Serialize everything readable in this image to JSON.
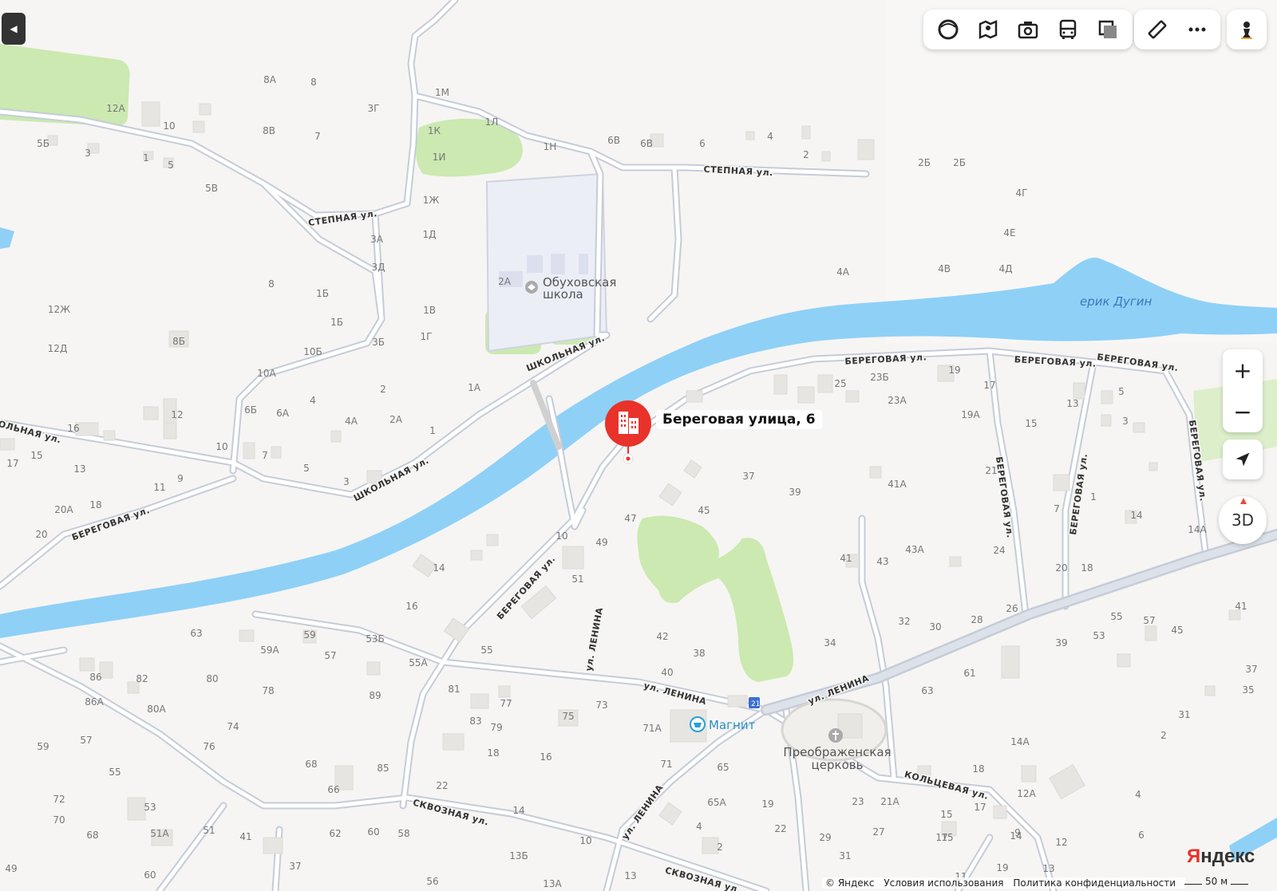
{
  "colors": {
    "water": "#8fd0f7",
    "park": "#cbe9b0",
    "road_fill": "#ffffff",
    "road_stroke": "#c5ccd8",
    "building": "#e9e7e3",
    "school_area": "#eceef6",
    "pin": "#e8322a",
    "label": "#6f6f6f",
    "street_label": "#333333",
    "water_label": "#3d78b8"
  },
  "toolbar": {
    "icons": [
      "layers-icon",
      "panorama-icon",
      "photo-icon",
      "transit-icon",
      "overlay-icon"
    ],
    "tools": [
      "ruler-icon",
      "more-icon"
    ],
    "profile": "pawn-icon"
  },
  "controls": {
    "zoom_in": "+",
    "zoom_out": "−",
    "three_d": "3D"
  },
  "pin": {
    "label": "Береговая улица, 6"
  },
  "brand": {
    "first": "Я",
    "rest": "ндекс"
  },
  "footer": {
    "copyright": "© Яндекс",
    "terms": "Условия использования",
    "privacy": "Политика конфиденциальности"
  },
  "scale": "50 м",
  "pois": [
    {
      "name": "Обуховская",
      "name2": "школа",
      "icon": "school-icon"
    },
    {
      "name": "Магнит",
      "icon": "shop-icon"
    },
    {
      "name": "Преображенская",
      "name2": "церковь",
      "icon": "church-icon"
    }
  ],
  "water_label": "ерик Дугин",
  "street_labels": [
    "СТЕПНАЯ ул.",
    "СТЕПНАЯ ул.",
    "ШКОЛЬНАЯ ул.",
    "ШКОЛЬНАЯ ул.",
    "ШКОЛЬНАЯ ул.",
    "БЕРЕГОВАЯ ул.",
    "БЕРЕГОВАЯ ул.",
    "БЕРЕГОВАЯ ул.",
    "БЕРЕГОВАЯ ул.",
    "БЕРЕГОВАЯ ул.",
    "БЕРЕГОВАЯ ул.",
    "БЕРЕГОВАЯ ул.",
    "БЕРЕГОВАЯ ул.",
    "ул. ЛЕНИНА",
    "ул. ЛЕНИНА",
    "ул. ЛЕНИНА",
    "ул. ЛЕНИНА",
    "СКВОЗНАЯ ул.",
    "СКВОЗНАЯ ул.",
    "КОЛЬЦЕВАЯ ул."
  ],
  "house_numbers": [
    "8А",
    "8",
    "12А",
    "10",
    "8В",
    "3Г",
    "7",
    "1М",
    "1Л",
    "1К",
    "1И",
    "1Н",
    "6В",
    "6В",
    "6",
    "4",
    "2",
    "2Б",
    "2Б",
    "5Б",
    "3",
    "1",
    "5",
    "5В",
    "1Ж",
    "1Д",
    "3А",
    "3Д",
    "4Г",
    "4Е",
    "4А",
    "4В",
    "4Д",
    "8",
    "1Б",
    "1Б",
    "12Ж",
    "8Б",
    "1В",
    "1Г",
    "3Б",
    "10Б",
    "12Д",
    "10А",
    "2А",
    "2",
    "1А",
    "4",
    "6Б",
    "6А",
    "4А",
    "2А",
    "1",
    "12",
    "16",
    "10",
    "7",
    "5",
    "3",
    "17",
    "15",
    "13",
    "11",
    "9",
    "18",
    "20А",
    "20",
    "25",
    "23Б",
    "19",
    "17",
    "23А",
    "19А",
    "13",
    "5",
    "3",
    "15",
    "21",
    "41А",
    "1",
    "14",
    "14А",
    "7",
    "37",
    "39",
    "45",
    "47",
    "41",
    "43",
    "43А",
    "24",
    "20",
    "18",
    "10",
    "49",
    "14",
    "51",
    "16",
    "42",
    "38",
    "40",
    "34",
    "32",
    "30",
    "28",
    "26",
    "41",
    "63",
    "59",
    "59А",
    "57",
    "53Б",
    "55А",
    "55",
    "53",
    "45",
    "39",
    "55",
    "57",
    "61",
    "63",
    "37",
    "35",
    "31",
    "2",
    "86",
    "82",
    "80",
    "78",
    "86А",
    "80А",
    "74",
    "76",
    "89",
    "81",
    "77",
    "73",
    "75",
    "71А",
    "83",
    "79",
    "85",
    "68",
    "66",
    "59",
    "57",
    "55",
    "72",
    "53",
    "51А",
    "51",
    "70",
    "68",
    "41",
    "62",
    "60",
    "58",
    "22",
    "16",
    "18",
    "71",
    "65",
    "65А",
    "19",
    "4",
    "2",
    "14",
    "14А",
    "18",
    "12А",
    "23",
    "21А",
    "17",
    "15",
    "14",
    "29",
    "27",
    "22",
    "12",
    "9",
    "6",
    "4",
    "13Б",
    "10",
    "13",
    "49",
    "37",
    "15",
    "19",
    "17",
    "13",
    "11",
    "60",
    "13А",
    "56",
    "31"
  ]
}
